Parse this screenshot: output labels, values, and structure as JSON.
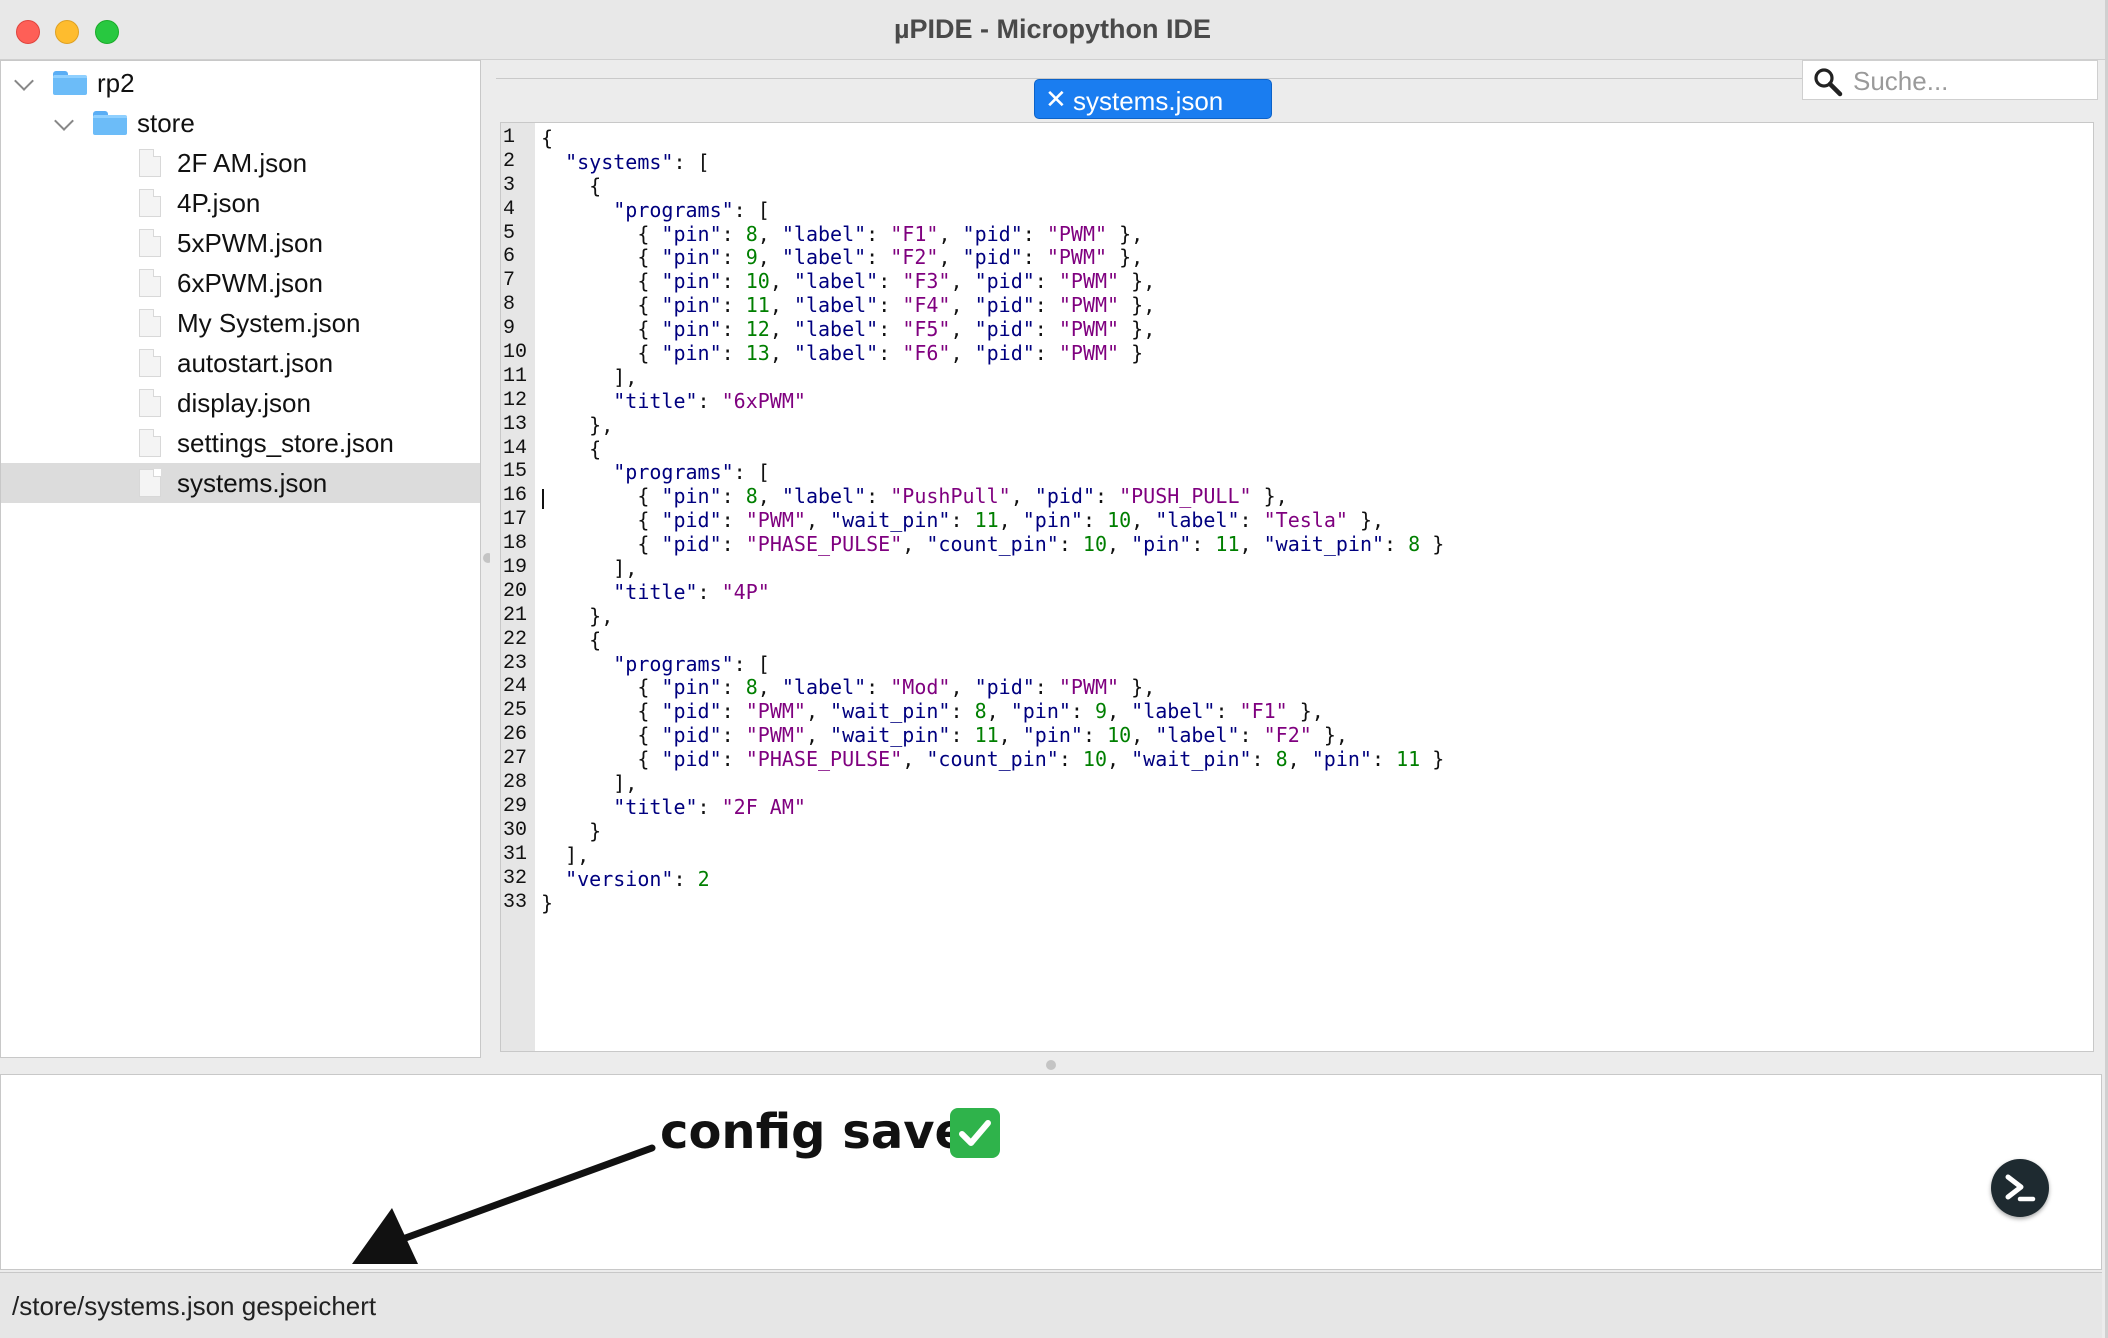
{
  "window": {
    "title": "µPIDE - Micropython IDE"
  },
  "sidebar": {
    "root": "rp2",
    "folder": "store",
    "files": [
      "2F AM.json",
      "4P.json",
      "5xPWM.json",
      "6xPWM.json",
      "My System.json",
      "autostart.json",
      "display.json",
      "settings_store.json",
      "systems.json"
    ],
    "selected": "systems.json"
  },
  "editor": {
    "tab": {
      "label": "systems.json",
      "close": "✕"
    },
    "search": {
      "placeholder": "Suche..."
    },
    "line_numbers": [
      "1",
      "2",
      "3",
      "4",
      "5",
      "6",
      "7",
      "8",
      "9",
      "10",
      "11",
      "12",
      "13",
      "14",
      "15",
      "16",
      "17",
      "18",
      "19",
      "20",
      "21",
      "22",
      "23",
      "24",
      "25",
      "26",
      "27",
      "28",
      "29",
      "30",
      "31",
      "32",
      "33"
    ],
    "code_lines": [
      "{",
      "  \"systems\": [",
      "    {",
      "      \"programs\": [",
      "        { \"pin\": 8, \"label\": \"F1\", \"pid\": \"PWM\" },",
      "        { \"pin\": 9, \"label\": \"F2\", \"pid\": \"PWM\" },",
      "        { \"pin\": 10, \"label\": \"F3\", \"pid\": \"PWM\" },",
      "        { \"pin\": 11, \"label\": \"F4\", \"pid\": \"PWM\" },",
      "        { \"pin\": 12, \"label\": \"F5\", \"pid\": \"PWM\" },",
      "        { \"pin\": 13, \"label\": \"F6\", \"pid\": \"PWM\" }",
      "      ],",
      "      \"title\": \"6xPWM\"",
      "    },",
      "    {",
      "      \"programs\": [",
      "        { \"pin\": 8, \"label\": \"PushPull\", \"pid\": \"PUSH_PULL\" },",
      "        { \"pid\": \"PWM\", \"wait_pin\": 11, \"pin\": 10, \"label\": \"Tesla\" },",
      "        { \"pid\": \"PHASE_PULSE\", \"count_pin\": 10, \"pin\": 11, \"wait_pin\": 8 }",
      "      ],",
      "      \"title\": \"4P\"",
      "    },",
      "    {",
      "      \"programs\": [",
      "        { \"pin\": 8, \"label\": \"Mod\", \"pid\": \"PWM\" },",
      "        { \"pid\": \"PWM\", \"wait_pin\": 8, \"pin\": 9, \"label\": \"F1\" },",
      "        { \"pid\": \"PWM\", \"wait_pin\": 11, \"pin\": 10, \"label\": \"F2\" },",
      "        { \"pid\": \"PHASE_PULSE\", \"count_pin\": 10, \"wait_pin\": 8, \"pin\": 11 }",
      "      ],",
      "      \"title\": \"2F AM\"",
      "    }",
      "  ],",
      "  \"version\": 2",
      "}"
    ]
  },
  "console": {
    "annotation": "config saved",
    "annotation_emoji": "✅",
    "terminal_icon": "terminal-icon"
  },
  "statusbar": {
    "message": "/store/systems.json gespeichert"
  },
  "colors": {
    "accent": "#1a7df0",
    "key": "#00007f",
    "number": "#007f00",
    "string": "#7f007f",
    "selection": "#dcdcdc"
  }
}
